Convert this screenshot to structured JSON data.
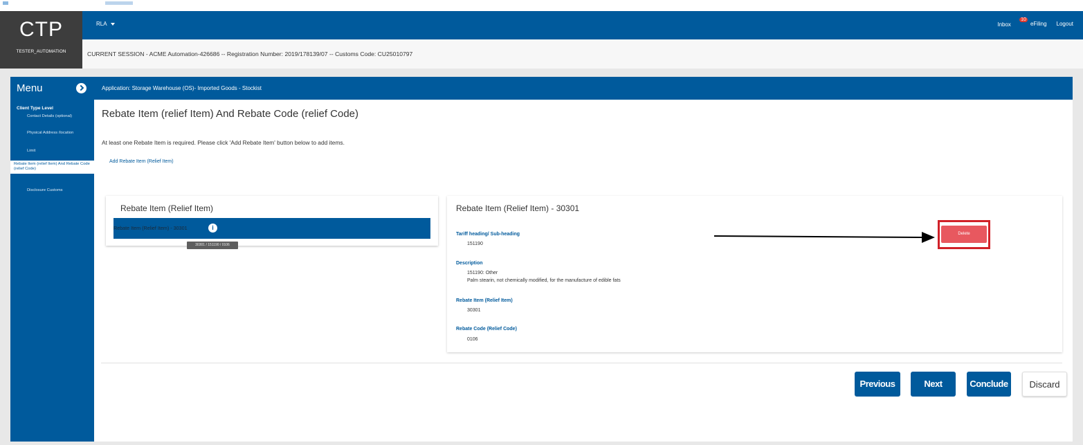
{
  "brand": {
    "logo": "CTP",
    "user": "TESTER_AUTOMATION"
  },
  "topbar": {
    "dropdown_label": "RLA",
    "inbox_label": "Inbox",
    "inbox_count": "10",
    "efiling_label": "eFiling",
    "logout_label": "Logout"
  },
  "session": {
    "text": "CURRENT SESSION - ACME Automation-426686 -- Registration Number: 2019/178139/07 -- Customs Code: CU25010797"
  },
  "sidebar": {
    "title": "Menu",
    "level": "Client Type Level",
    "items": [
      {
        "label": "Contact Details (optional)"
      },
      {
        "label": "Physical Address /location"
      },
      {
        "label": "Limit"
      },
      {
        "label": "Rebate Item (relief Item) And Rebate Code (relief Code)"
      },
      {
        "label": "Disclosure Customs"
      }
    ]
  },
  "app_bar": {
    "text": "Application: Storage Warehouse (OS)- Imported Goods - Stockist"
  },
  "page": {
    "title": "Rebate Item (relief Item) And Rebate Code (relief Code)",
    "info": "At least one Rebate Item is required. Please click 'Add Rebate Item' button below to add items.",
    "add_link": "Add Rebate Item (Relief Item)"
  },
  "left_card": {
    "title": "Rebate Item (Relief Item)",
    "row_label": "Rebate Item (Relief Item) - 30301",
    "info_icon": "i",
    "tooltip": "30301 / 151190 / 0106"
  },
  "right_card": {
    "title": "Rebate Item (Relief Item) - 30301",
    "tariff_label": "Tariff heading/ Sub-heading",
    "tariff_value": "151190",
    "description_label": "Description",
    "description_line1": "151190: Other",
    "description_line2": "Palm stearin, not chemically modified, for the manufacture of edible fats",
    "rebate_item_label": "Rebate Item (Relief Item)",
    "rebate_item_value": "30301",
    "rebate_code_label": "Rebate Code (Relief Code)",
    "rebate_code_value": "0106",
    "delete_label": "Delete"
  },
  "footer": {
    "previous": "Previous",
    "next": "Next",
    "conclude": "Conclude",
    "discard": "Discard"
  },
  "colors": {
    "primary": "#005a9c",
    "brand_bg": "#3d3d3d",
    "delete": "#e8585f",
    "highlight_frame": "#d12128",
    "badge": "#e03a2e"
  }
}
